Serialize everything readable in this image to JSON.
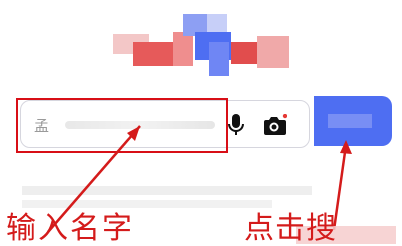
{
  "search": {
    "placeholder_text": "孟"
  },
  "annotations": {
    "enter_name_label": "输入名字",
    "click_label": "点击搜"
  },
  "colors": {
    "accent_blue": "#4e6ef2",
    "annotation_red": "#d80f17"
  },
  "icons": {
    "mic": "microphone-icon",
    "camera": "camera-icon"
  }
}
